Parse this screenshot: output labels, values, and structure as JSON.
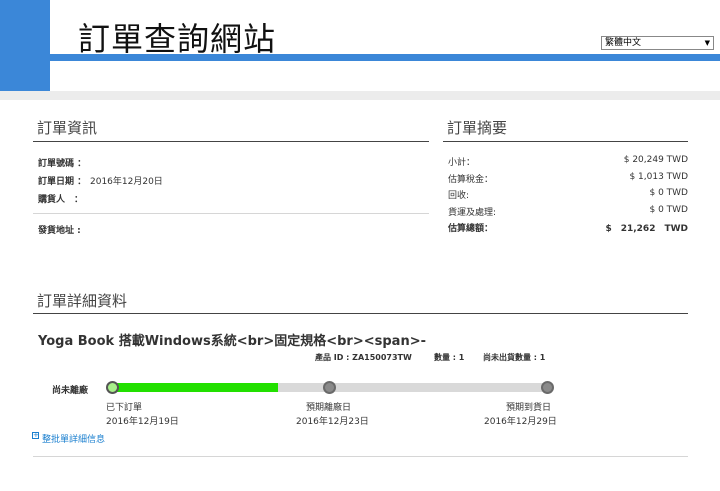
{
  "header": {
    "site_title": "訂單查詢網站",
    "language": "繁體中文",
    "brand_color": "#3b87d8"
  },
  "order_info": {
    "title": "訂單資訊",
    "order_number_label": "訂單號碼 ：",
    "order_number": "",
    "order_date_label": "訂單日期 ：",
    "order_date": "2016年12月20日",
    "buyer_label": "購貨人　：",
    "buyer": "",
    "shipping_address_label": "發貨地址 :",
    "shipping_address": ""
  },
  "order_summary": {
    "title": "訂單摘要",
    "rows": [
      {
        "label": "小計：",
        "value": "$ 20,249 TWD"
      },
      {
        "label": "估算稅金：",
        "value": "$ 1,013 TWD"
      },
      {
        "label": "回收:",
        "value": "$ 0 TWD"
      },
      {
        "label": "貨運及處理:",
        "value": "$ 0 TWD"
      }
    ],
    "total_label": "估算總額：",
    "total_value": "$　21,262　TWD"
  },
  "order_details": {
    "title": "訂單詳細資料",
    "product_name": "Yoga Book 搭載Windows系統<br>固定規格<br><span>-",
    "product_id": "產品 ID : ZA150073TW",
    "quantity": "數量 : 1",
    "unshipped_quantity": "尚未出貨數量 : 1",
    "status": "尚未離廠",
    "progress_fraction": 0.38,
    "progress_color": "#22e000",
    "steps": [
      {
        "label": "已下訂單",
        "date": "2016年12月19日"
      },
      {
        "label": "預期離廠日",
        "date": "2016年12月23日"
      },
      {
        "label": "預期到貨日",
        "date": "2016年12月29日"
      }
    ],
    "details_link": "整批單詳細信息",
    "link_icon": "plus-box-icon"
  }
}
